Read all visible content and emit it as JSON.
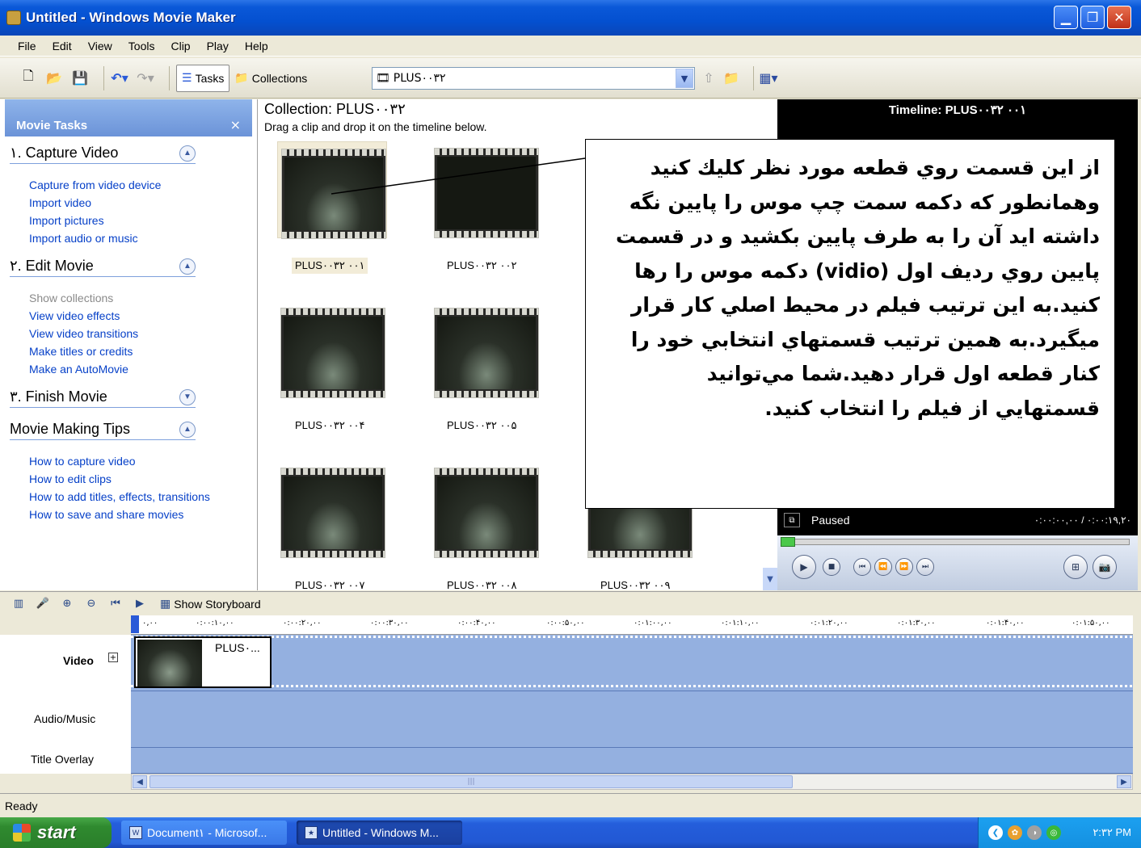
{
  "window": {
    "title": "Untitled - Windows Movie Maker"
  },
  "menu": [
    "File",
    "Edit",
    "View",
    "Tools",
    "Clip",
    "Play",
    "Help"
  ],
  "toolbar": {
    "tasks_label": "Tasks",
    "collections_label": "Collections",
    "collection_combo": "PLUS۰۰۳۲"
  },
  "tasks_pane": {
    "header": "Movie Tasks",
    "close": "×",
    "sections": [
      {
        "title": "۱. Capture Video",
        "expanded": true,
        "links": [
          "Capture from video device",
          "Import video",
          "Import pictures",
          "Import audio or music"
        ]
      },
      {
        "title": "۲. Edit Movie",
        "expanded": true,
        "links": [
          "Show collections",
          "View video effects",
          "View video transitions",
          "Make titles or credits",
          "Make an AutoMovie"
        ]
      },
      {
        "title": "۳. Finish Movie",
        "expanded": false,
        "links": []
      },
      {
        "title": "Movie Making Tips",
        "expanded": true,
        "links": [
          "How to capture video",
          "How to edit clips",
          "How to add titles, effects, transitions",
          "How to save and share movies"
        ]
      }
    ]
  },
  "collection": {
    "title": "Collection: PLUS۰۰۳۲",
    "subtitle": "Drag a clip and drop it on the timeline below.",
    "clips": [
      "PLUS۰۰۳۲ ۰۰۱",
      "PLUS۰۰۳۲ ۰۰۲",
      "PLUS۰۰۳۲ ۰۰۴",
      "PLUS۰۰۳۲ ۰۰۵",
      "PLUS۰۰۳۲ ۰۰۷",
      "PLUS۰۰۳۲ ۰۰۸",
      "PLUS۰۰۳۲ ۰۰۹"
    ]
  },
  "monitor": {
    "title": "Timeline: PLUS۰۰۳۲ ۰۰۱",
    "status": "Paused",
    "time": "۰:۰۰:۰۰,۰۰ / ۰:۰۰:۱۹,۲۰"
  },
  "callout": {
    "text": "از اين قسمت روي قطعه مورد نظر کليك کنيد وهمانطور که دکمه سمت چپ موس را پايين نگه داشته ايد آن را به طرف پايين بکشيد و در قسمت پايين روي رديف اول (vidio) دکمه موس را رها کنيد.به اين ترتيب فيلم در محيط اصلي کار قرار ميگيرد.به همين ترتيب قسمتهاي انتخابي خود را کنار قطعه اول قرار دهيد.شما مي‌توانيد قسمتهايي از فيلم را انتخاب کنيد."
  },
  "timeline": {
    "storyboard_label": "Show Storyboard",
    "ruler_ticks": [
      "۰,۰۰",
      "۰:۰۰:۱۰,۰۰",
      "۰:۰۰:۲۰,۰۰",
      "۰:۰۰:۳۰,۰۰",
      "۰:۰۰:۴۰,۰۰",
      "۰:۰۰:۵۰,۰۰",
      "۰:۰۱:۰۰,۰۰",
      "۰:۰۱:۱۰,۰۰",
      "۰:۰۱:۲۰,۰۰",
      "۰:۰۱:۳۰,۰۰",
      "۰:۰۱:۴۰,۰۰",
      "۰:۰۱:۵۰,۰۰"
    ],
    "tracks": {
      "video": "Video",
      "audio": "Audio/Music",
      "overlay": "Title Overlay"
    },
    "video_clip_name": "PLUS۰..."
  },
  "status": {
    "text": "Ready"
  },
  "taskbar": {
    "start": "start",
    "buttons": [
      "Document۱ - Microsof...",
      "Untitled - Windows M..."
    ],
    "clock": "۲:۳۲ PM"
  }
}
